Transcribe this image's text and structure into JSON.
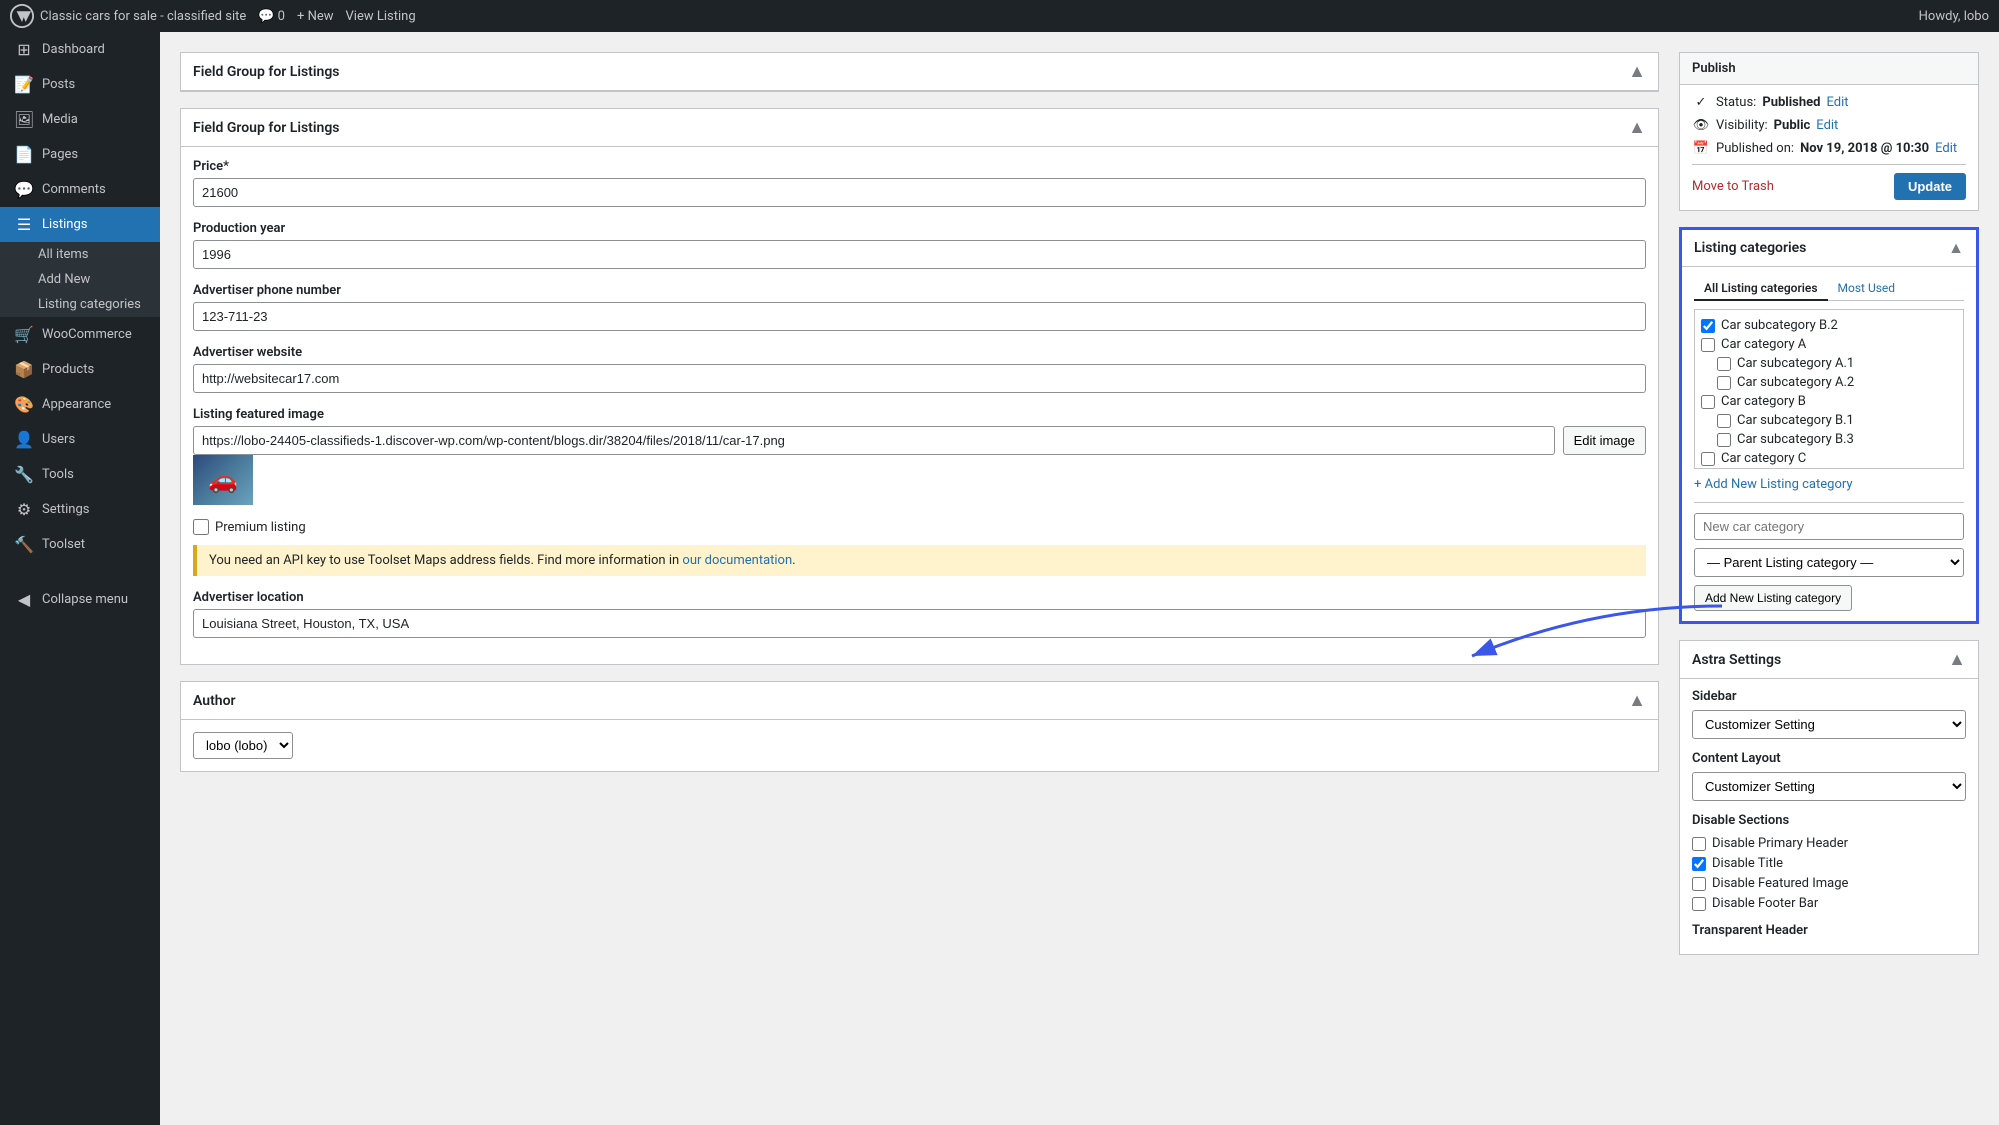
{
  "adminbar": {
    "site_name": "Classic cars for sale - classified site",
    "comments_count": "0",
    "new_label": "+ New",
    "view_label": "View Listing",
    "howdy": "Howdy, lobo"
  },
  "sidebar": {
    "items": [
      {
        "id": "dashboard",
        "label": "Dashboard",
        "icon": "⊞"
      },
      {
        "id": "posts",
        "label": "Posts",
        "icon": "📝"
      },
      {
        "id": "media",
        "label": "Media",
        "icon": "🖼"
      },
      {
        "id": "pages",
        "label": "Pages",
        "icon": "📄"
      },
      {
        "id": "comments",
        "label": "Comments",
        "icon": "💬"
      },
      {
        "id": "listings",
        "label": "Listings",
        "icon": "☰",
        "current": true
      },
      {
        "id": "woocommerce",
        "label": "WooCommerce",
        "icon": "🛒"
      },
      {
        "id": "products",
        "label": "Products",
        "icon": "📦"
      },
      {
        "id": "appearance",
        "label": "Appearance",
        "icon": "🎨"
      },
      {
        "id": "users",
        "label": "Users",
        "icon": "👤"
      },
      {
        "id": "tools",
        "label": "Tools",
        "icon": "🔧"
      },
      {
        "id": "settings",
        "label": "Settings",
        "icon": "⚙"
      },
      {
        "id": "toolset",
        "label": "Toolset",
        "icon": "🔨"
      },
      {
        "id": "collapse",
        "label": "Collapse menu",
        "icon": "◀"
      }
    ],
    "submenu": {
      "listings": [
        {
          "id": "all-items",
          "label": "All items",
          "current": false
        },
        {
          "id": "add-new",
          "label": "Add New",
          "current": false
        },
        {
          "id": "listing-categories",
          "label": "Listing categories",
          "current": false
        }
      ]
    }
  },
  "field_group": {
    "title": "Field Group for Listings",
    "title2": "Field Group for Listings",
    "fields": {
      "price_label": "Price*",
      "price_value": "21600",
      "production_year_label": "Production year",
      "production_year_value": "1996",
      "phone_label": "Advertiser phone number",
      "phone_value": "123-711-23",
      "website_label": "Advertiser website",
      "website_value": "http://websitecar17.com",
      "featured_image_label": "Listing featured image",
      "featured_image_value": "https://lobo-24405-classifieds-1.discover-wp.com/wp-content/blogs.dir/38204/files/2018/11/car-17.png",
      "edit_image_btn": "Edit image",
      "premium_label": "Premium listing",
      "notice_text": "You need an API key to use Toolset Maps address fields. Find more information in",
      "notice_link": "our documentation",
      "location_label": "Advertiser location",
      "location_value": "Louisiana Street, Houston, TX, USA"
    }
  },
  "author_section": {
    "title": "Author",
    "author_value": "lobo (lobo)"
  },
  "publish_box": {
    "title": "Publish",
    "status_label": "Status:",
    "status_value": "Published",
    "status_edit": "Edit",
    "visibility_label": "Visibility:",
    "visibility_value": "Public",
    "visibility_edit": "Edit",
    "published_label": "Published on:",
    "published_value": "Nov 19, 2018 @ 10:30",
    "published_edit": "Edit",
    "move_to_trash": "Move to Trash",
    "update_btn": "Update"
  },
  "listing_categories": {
    "title": "Listing categories",
    "tab_all": "All Listing categories",
    "tab_most_used": "Most Used",
    "categories": [
      {
        "id": "sub_b2",
        "label": "Car subcategory B.2",
        "checked": true,
        "level": 0
      },
      {
        "id": "cat_a",
        "label": "Car category A",
        "checked": false,
        "level": 0
      },
      {
        "id": "sub_a1",
        "label": "Car subcategory A.1",
        "checked": false,
        "level": 1
      },
      {
        "id": "sub_a2",
        "label": "Car subcategory A.2",
        "checked": false,
        "level": 1
      },
      {
        "id": "cat_b",
        "label": "Car category B",
        "checked": false,
        "level": 0
      },
      {
        "id": "sub_b1",
        "label": "Car subcategory B.1",
        "checked": false,
        "level": 1
      },
      {
        "id": "sub_b3",
        "label": "Car subcategory B.3",
        "checked": false,
        "level": 1
      },
      {
        "id": "cat_c",
        "label": "Car category C",
        "checked": false,
        "level": 0
      }
    ],
    "add_new_link": "+ Add New Listing category",
    "new_cat_placeholder": "New car category",
    "parent_placeholder": "— Parent Listing category —",
    "add_btn": "Add New Listing category"
  },
  "astra_settings": {
    "title": "Astra Settings",
    "sidebar_label": "Sidebar",
    "sidebar_value": "Customizer Setting",
    "content_layout_label": "Content Layout",
    "content_layout_value": "Customizer Setting",
    "disable_sections_title": "Disable Sections",
    "disable_checks": [
      {
        "id": "dis_primary_header",
        "label": "Disable Primary Header",
        "checked": false
      },
      {
        "id": "dis_title",
        "label": "Disable Title",
        "checked": true
      },
      {
        "id": "dis_featured_image",
        "label": "Disable Featured Image",
        "checked": false
      },
      {
        "id": "dis_footer_bar",
        "label": "Disable Footer Bar",
        "checked": false
      }
    ],
    "transparent_header_label": "Transparent Header"
  },
  "colors": {
    "accent": "#2271b1",
    "highlight_border": "#3a57e8",
    "arrow_color": "#3a57e8"
  }
}
